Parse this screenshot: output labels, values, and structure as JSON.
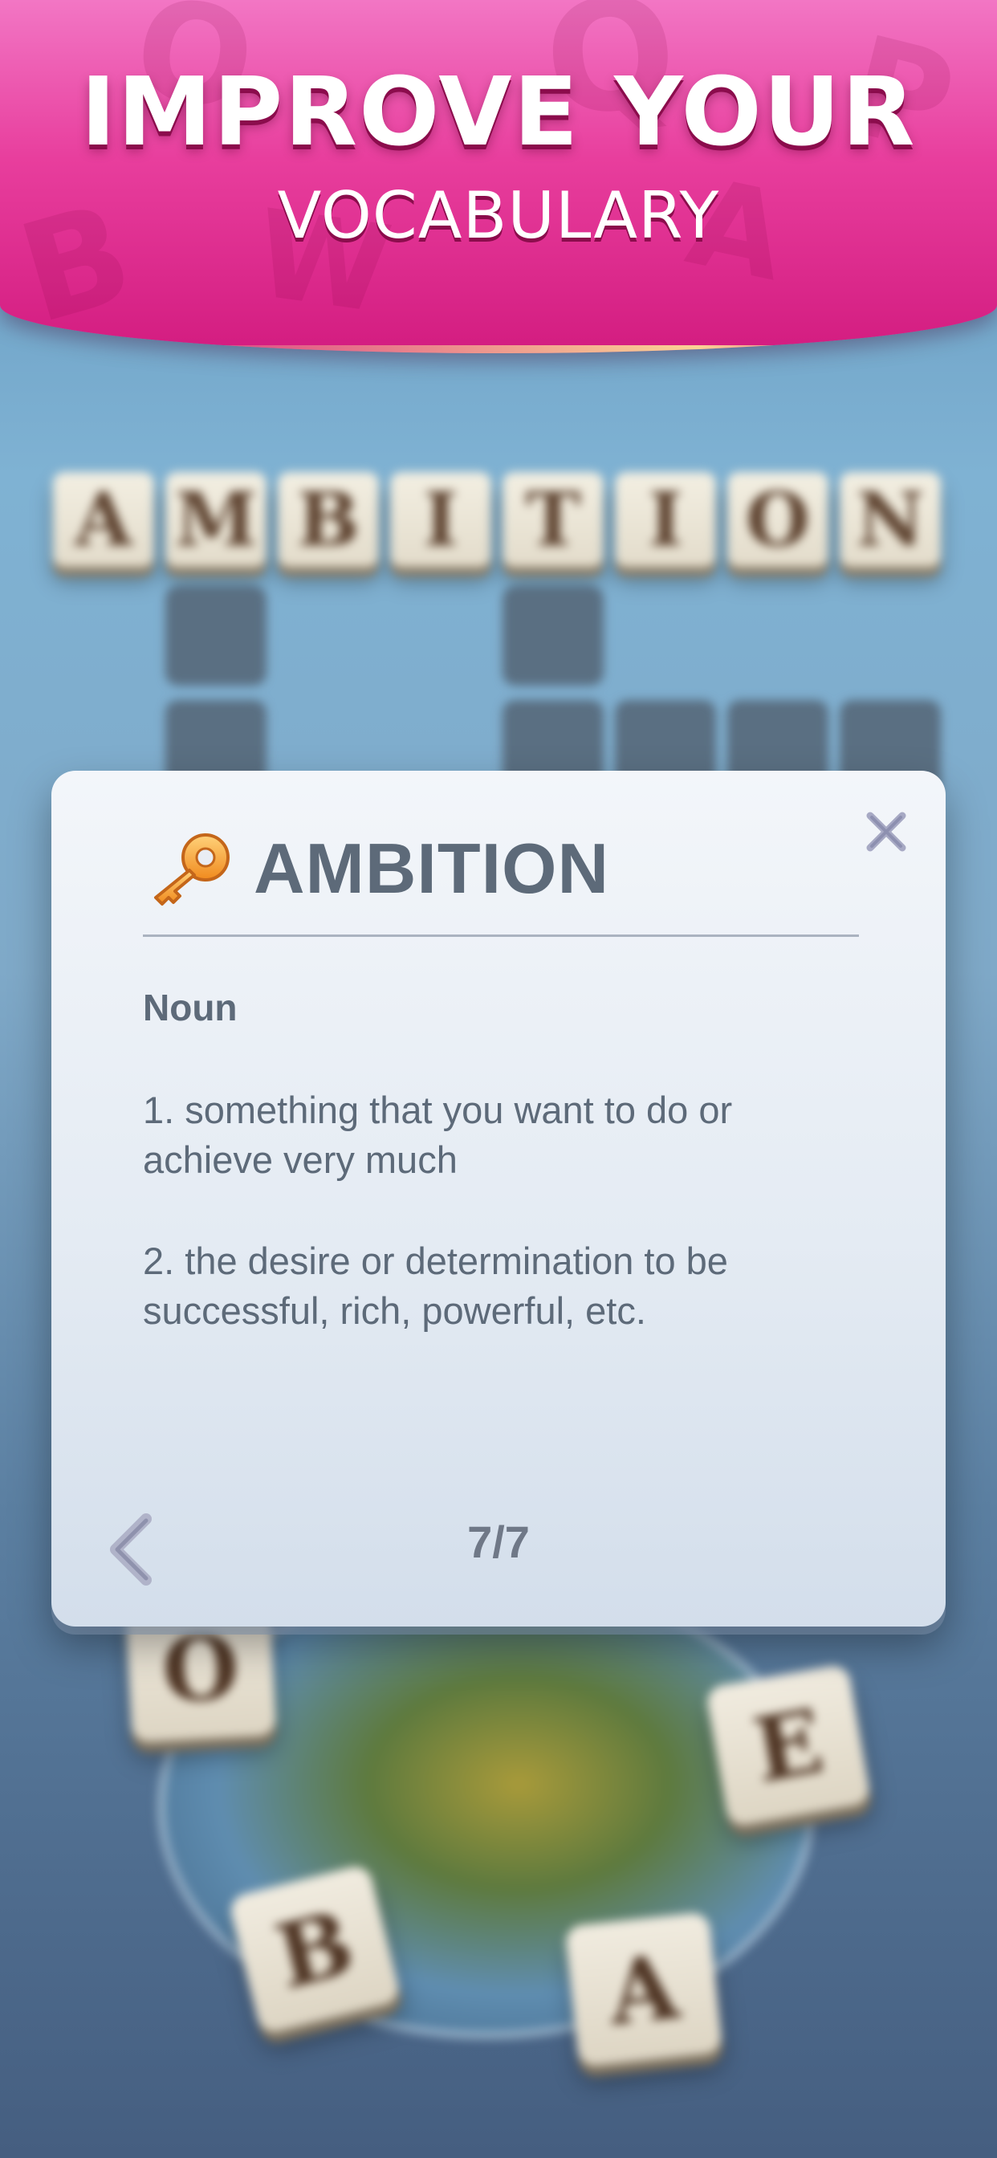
{
  "banner": {
    "title": "IMPROVE YOUR",
    "subtitle": "VOCABULARY"
  },
  "board": {
    "answer_tiles": [
      "A",
      "M",
      "B",
      "I",
      "T",
      "I",
      "O",
      "N"
    ],
    "wheel_letters": [
      "O",
      "E",
      "B",
      "A"
    ]
  },
  "dialog": {
    "word": "AMBITION",
    "part_of_speech": "Noun",
    "definitions": [
      "1. something that you want to do or achieve very much",
      "2. the desire or determination to be successful, rich, powerful, etc."
    ],
    "page_indicator": "7/7",
    "icons": {
      "word_icon": "key-icon",
      "close": "close-icon",
      "previous": "chevron-left-icon"
    }
  },
  "colors": {
    "banner_pink": "#e83e9d",
    "dialog_text": "#5d6a79",
    "tile_letter": "#5e4330"
  }
}
